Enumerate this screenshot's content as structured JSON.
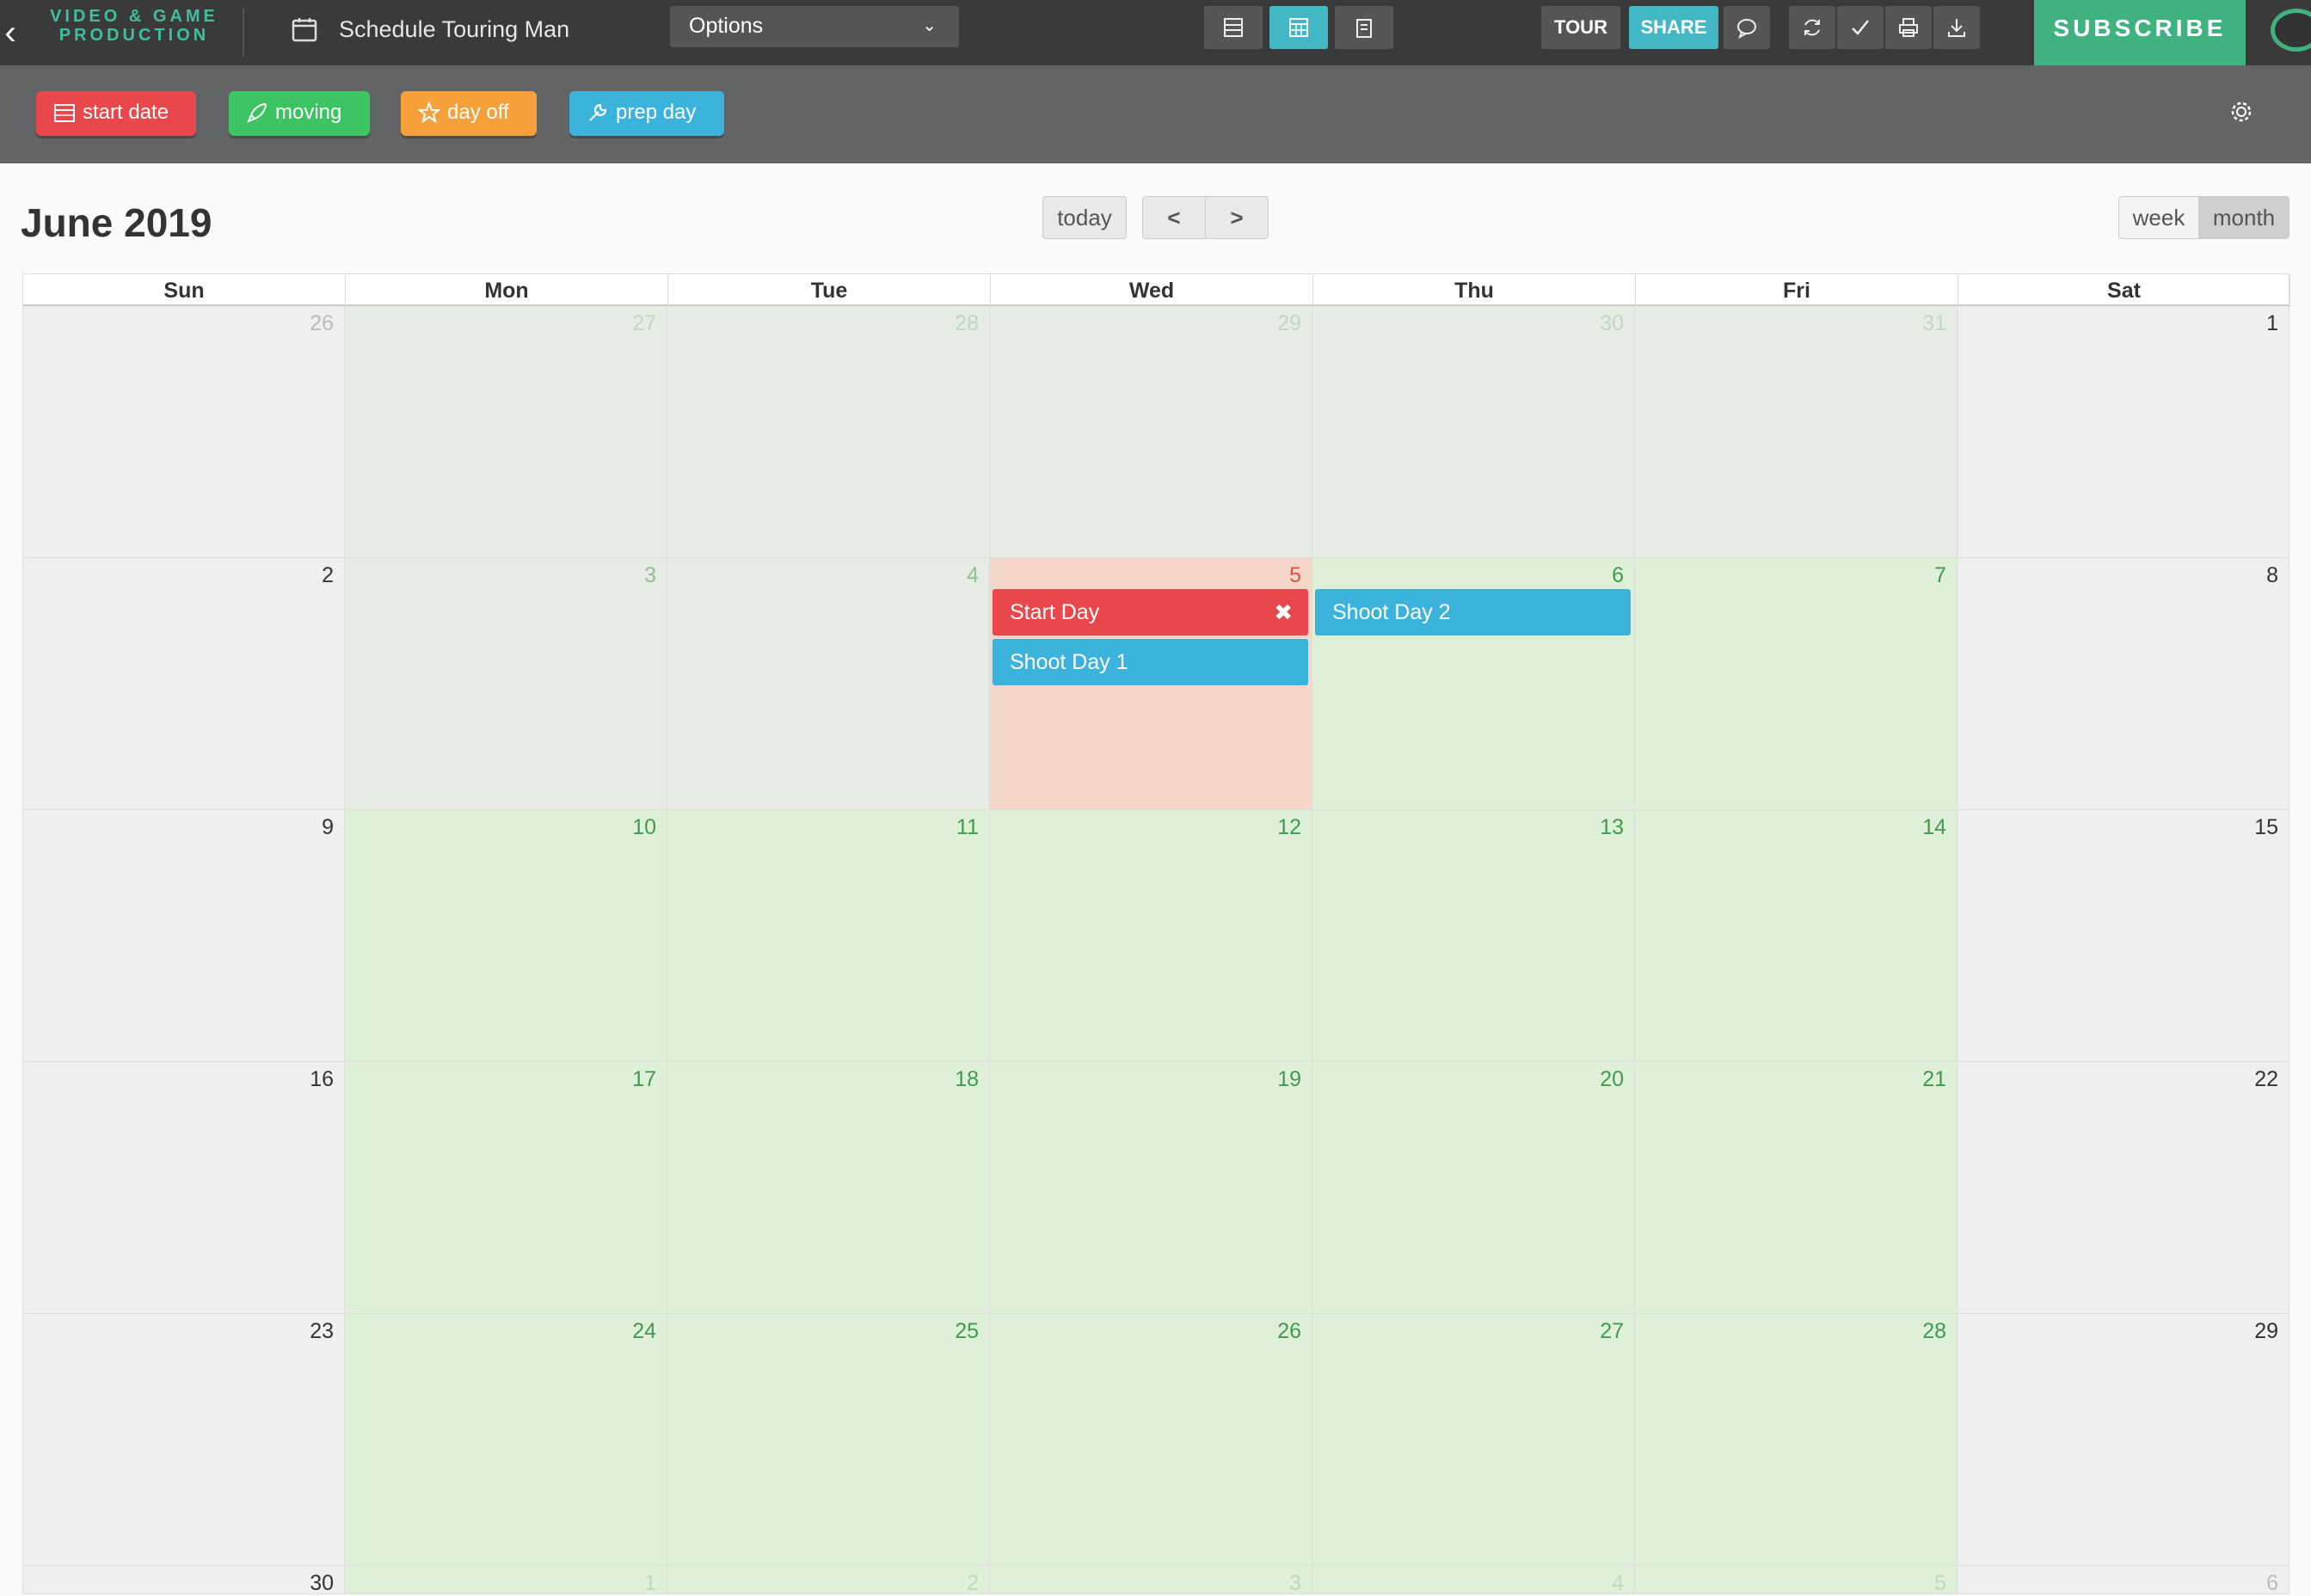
{
  "app": {
    "brand_line1": "VIDEO & GAME",
    "brand_line2": "PRODUCTION",
    "back_icon": "chevron-left-icon",
    "doc_title": "Schedule Touring Man",
    "options_label": "Options",
    "tour_label": "TOUR",
    "share_label": "SHARE",
    "subscribe_label": "SUBSCRIBE"
  },
  "toolbar_icons": [
    "list-view-icon",
    "calendar-view-icon",
    "clipboard-icon",
    "comment-icon",
    "refresh-icon",
    "check-icon",
    "print-icon",
    "download-icon"
  ],
  "tags": [
    {
      "label": "start date",
      "icon": "calendar-icon",
      "color": "#e8474b"
    },
    {
      "label": "moving",
      "icon": "rocket-icon",
      "color": "#3cc463"
    },
    {
      "label": "day off",
      "icon": "star-icon",
      "color": "#f5a03a"
    },
    {
      "label": "prep day",
      "icon": "wrench-icon",
      "color": "#3cb3dc"
    }
  ],
  "calendar": {
    "title": "June 2019",
    "today_label": "today",
    "prev_icon": "chevron-left-icon",
    "next_icon": "chevron-right-icon",
    "week_label": "week",
    "month_label": "month",
    "weekdays": [
      "Sun",
      "Mon",
      "Tue",
      "Wed",
      "Thu",
      "Fri",
      "Sat"
    ],
    "weeks": [
      [
        "26",
        "27",
        "28",
        "29",
        "30",
        "31",
        "1"
      ],
      [
        "2",
        "3",
        "4",
        "5",
        "6",
        "7",
        "8"
      ],
      [
        "9",
        "10",
        "11",
        "12",
        "13",
        "14",
        "15"
      ],
      [
        "16",
        "17",
        "18",
        "19",
        "20",
        "21",
        "22"
      ],
      [
        "23",
        "24",
        "25",
        "26",
        "27",
        "28",
        "29"
      ],
      [
        "30",
        "1",
        "2",
        "3",
        "4",
        "5",
        "6"
      ]
    ],
    "events": [
      {
        "title": "Start Day",
        "date": "2019-06-05",
        "color": "#e8474b",
        "removable": true
      },
      {
        "title": "Shoot Day 1",
        "date": "2019-06-05",
        "color": "#3cb3dc",
        "removable": false
      },
      {
        "title": "Shoot Day 2",
        "date": "2019-06-06",
        "color": "#3cb3dc",
        "removable": false
      }
    ],
    "colors": {
      "start_day_bg": "#f4d7c9",
      "shoot_day_bg": "#dff0d8",
      "inactive_bg": "#e6ece4",
      "weekend_bg": "#efefef",
      "green_num": "#3f9a4f",
      "start_num": "#e0553a"
    }
  }
}
